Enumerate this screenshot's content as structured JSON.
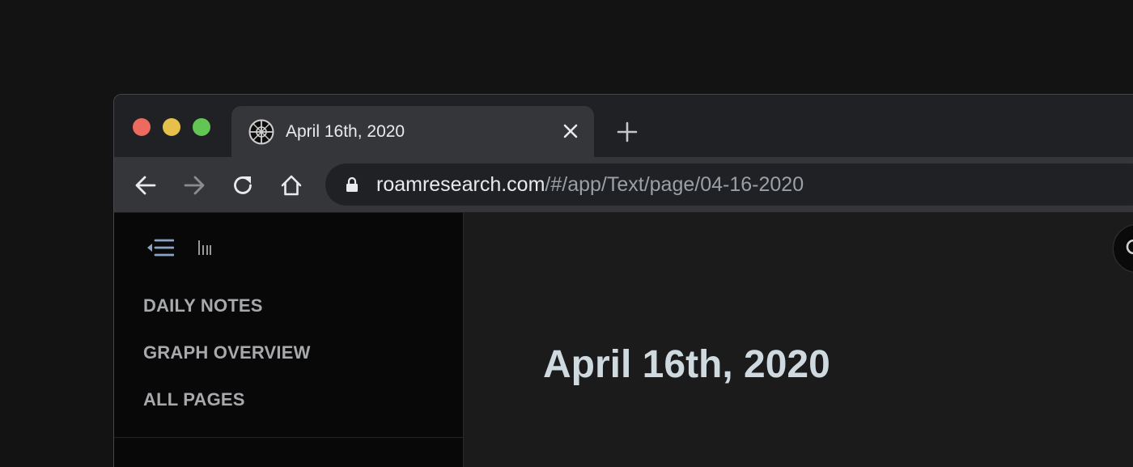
{
  "browser": {
    "tab": {
      "favicon": "roam-favicon-icon",
      "title": "April 16th, 2020",
      "close_icon": "close-icon"
    },
    "new_tab_icon": "plus-icon",
    "toolbar": {
      "back_icon": "arrow-left-icon",
      "forward_icon": "arrow-right-icon",
      "reload_icon": "reload-icon",
      "home_icon": "home-icon"
    },
    "omnibox": {
      "lock_icon": "lock-icon",
      "url_host": "roamresearch.com",
      "url_path": "/#/app/Text/page/04-16-2020"
    },
    "traffic_lights": {
      "close_color": "#ed6a5e",
      "minimize_color": "#e6c04a",
      "maximize_color": "#62c554"
    }
  },
  "sidebar": {
    "collapse_icon": "sidebar-collapse-icon",
    "shortcuts_icon": "shortcuts-icon",
    "items": [
      {
        "label": "DAILY NOTES"
      },
      {
        "label": "GRAPH OVERVIEW"
      },
      {
        "label": "ALL PAGES"
      }
    ]
  },
  "main": {
    "page_title": "April 16th, 2020",
    "search_icon": "search-icon"
  }
}
